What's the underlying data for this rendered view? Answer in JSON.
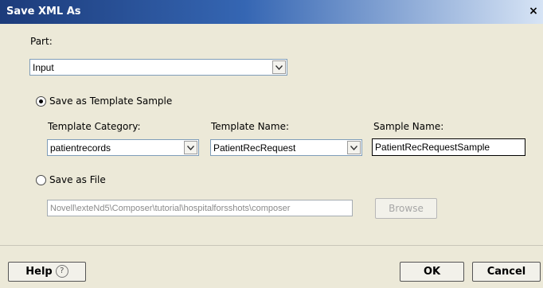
{
  "window": {
    "title": "Save XML As",
    "close_glyph": "×"
  },
  "part": {
    "label": "Part:",
    "value": "Input"
  },
  "template_option": {
    "label": "Save as Template Sample",
    "selected": true
  },
  "template_category": {
    "label": "Template Category:",
    "value": "patientrecords"
  },
  "template_name": {
    "label": "Template Name:",
    "value": "PatientRecRequest"
  },
  "sample_name": {
    "label": "Sample Name:",
    "value": "PatientRecRequestSample"
  },
  "file_option": {
    "label": "Save as File",
    "selected": false
  },
  "file_path": {
    "value": "Novell\\exteNd5\\Composer\\tutorial\\hospitalforsshots\\composer"
  },
  "buttons": {
    "browse": "Browse",
    "help": "Help",
    "help_icon_glyph": "?",
    "ok": "OK",
    "cancel": "Cancel"
  },
  "icons": {
    "dropdown": "chevron-down-icon",
    "help": "question-circle-icon",
    "close": "close-icon"
  }
}
